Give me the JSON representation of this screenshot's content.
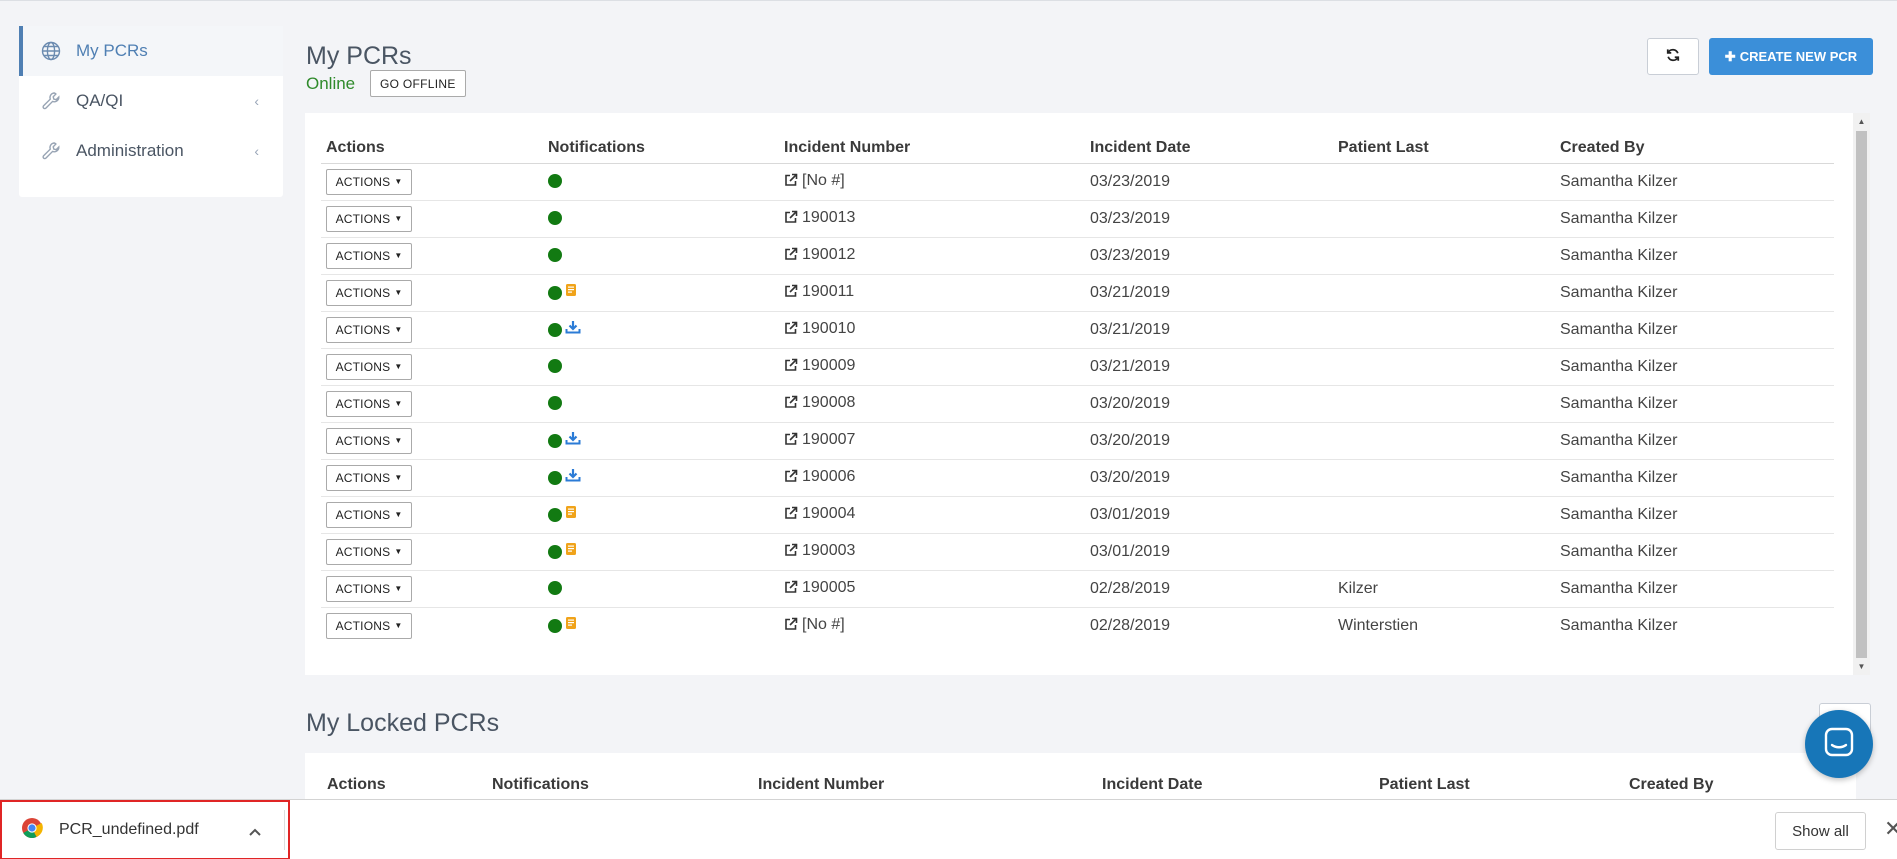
{
  "sidebar": {
    "items": [
      {
        "label": "My PCRs",
        "icon": "globe-icon",
        "active": true
      },
      {
        "label": "QA/QI",
        "icon": "wrench-icon",
        "chevron": "‹"
      },
      {
        "label": "Administration",
        "icon": "wrench-icon",
        "chevron": "‹"
      }
    ]
  },
  "header": {
    "title": "My PCRs",
    "status": "Online",
    "offline_button": "GO OFFLINE",
    "refresh_icon": "refresh-icon",
    "create_button": "CREATE NEW PCR",
    "create_icon": "plus-icon",
    "accent_color": "#3b8fd9"
  },
  "table": {
    "columns": [
      "Actions",
      "Notifications",
      "Incident Number",
      "Incident Date",
      "Patient Last",
      "Created By"
    ],
    "action_label": "ACTIONS",
    "rows": [
      {
        "notif": [
          "dot"
        ],
        "incident": "[No #]",
        "date": "03/23/2019",
        "patient": "",
        "created_by": "Samantha Kilzer"
      },
      {
        "notif": [
          "dot"
        ],
        "incident": "190013",
        "date": "03/23/2019",
        "patient": "",
        "created_by": "Samantha Kilzer"
      },
      {
        "notif": [
          "dot"
        ],
        "incident": "190012",
        "date": "03/23/2019",
        "patient": "",
        "created_by": "Samantha Kilzer"
      },
      {
        "notif": [
          "dot",
          "book"
        ],
        "incident": "190011",
        "date": "03/21/2019",
        "patient": "",
        "created_by": "Samantha Kilzer"
      },
      {
        "notif": [
          "dot",
          "download"
        ],
        "incident": "190010",
        "date": "03/21/2019",
        "patient": "",
        "created_by": "Samantha Kilzer"
      },
      {
        "notif": [
          "dot"
        ],
        "incident": "190009",
        "date": "03/21/2019",
        "patient": "",
        "created_by": "Samantha Kilzer"
      },
      {
        "notif": [
          "dot"
        ],
        "incident": "190008",
        "date": "03/20/2019",
        "patient": "",
        "created_by": "Samantha Kilzer"
      },
      {
        "notif": [
          "dot",
          "download"
        ],
        "incident": "190007",
        "date": "03/20/2019",
        "patient": "",
        "created_by": "Samantha Kilzer"
      },
      {
        "notif": [
          "dot",
          "download"
        ],
        "incident": "190006",
        "date": "03/20/2019",
        "patient": "",
        "created_by": "Samantha Kilzer"
      },
      {
        "notif": [
          "dot",
          "book"
        ],
        "incident": "190004",
        "date": "03/01/2019",
        "patient": "",
        "created_by": "Samantha Kilzer"
      },
      {
        "notif": [
          "dot",
          "book"
        ],
        "incident": "190003",
        "date": "03/01/2019",
        "patient": "",
        "created_by": "Samantha Kilzer"
      },
      {
        "notif": [
          "dot"
        ],
        "incident": "190005",
        "date": "02/28/2019",
        "patient": "Kilzer",
        "created_by": "Samantha Kilzer"
      },
      {
        "notif": [
          "dot",
          "book"
        ],
        "incident": "[No #]",
        "date": "02/28/2019",
        "patient": "Winterstien",
        "created_by": "Samantha Kilzer"
      }
    ]
  },
  "locked": {
    "title": "My Locked PCRs",
    "columns": [
      "Actions",
      "Notifications",
      "Incident Number",
      "Incident Date",
      "Patient Last",
      "Created By"
    ]
  },
  "download_bar": {
    "file_name": "PCR_undefined.pdf",
    "show_all": "Show all",
    "close": "✕"
  }
}
